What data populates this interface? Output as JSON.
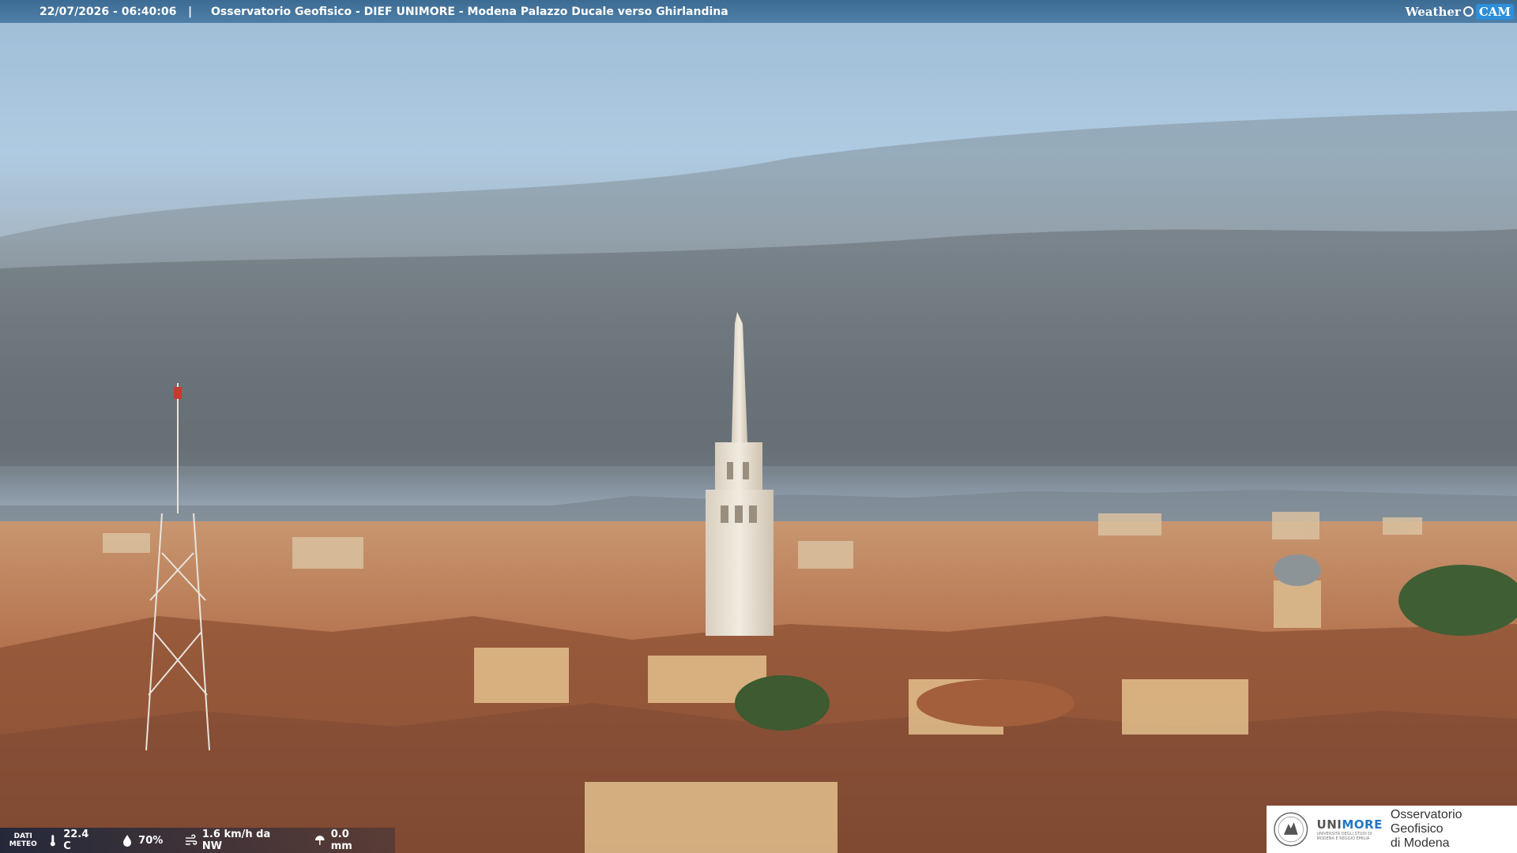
{
  "overlay": {
    "datetime": "22/07/2026 - 06:40:06",
    "separator": "|",
    "title": "Osservatorio Geofisico - DIEF UNIMORE - Modena Palazzo Ducale verso Ghirlandina",
    "brand_weather": "Weather",
    "brand_cam": "CAM"
  },
  "meteo": {
    "label_line1": "DATI",
    "label_line2": "METEO",
    "temperature": "22.4 C",
    "humidity": "70%",
    "wind": "1.6 km/h da NW",
    "rain": "0.0 mm",
    "icons": [
      "thermometer-icon",
      "humidity-drop-icon",
      "wind-icon",
      "rain-gauge-icon"
    ]
  },
  "logo": {
    "uni_prefix": "UNI",
    "uni_suffix": "MORE",
    "uni_sub": "UNIVERSITÀ DEGLI STUDI DI MODENA E REGGIO EMILIA",
    "obs_line1": "Osservatorio Geofisico",
    "obs_line2": "di Modena"
  },
  "colors": {
    "sky_top": "#a9c6de",
    "cloud_band": "#6a737c",
    "roof": "#b4704a",
    "tower": "#e9e2d6",
    "accent_blue": "#2277c6"
  }
}
